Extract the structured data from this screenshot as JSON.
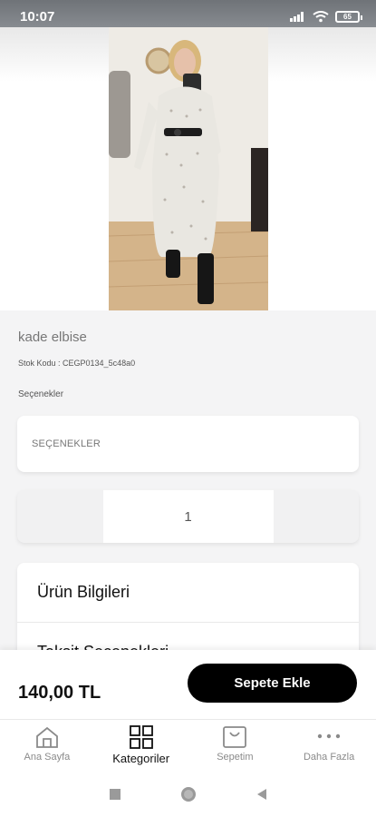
{
  "status_bar": {
    "time": "10:07",
    "battery": "65",
    "icons": [
      "signal-icon",
      "wifi-icon",
      "battery-icon"
    ]
  },
  "product": {
    "title": "kade elbise",
    "stock_code": "Stok Kodu : CEGP0134_5c48a0",
    "options_label": "Seçenekler",
    "options_placeholder": "SEÇENEKLER",
    "quantity": "1"
  },
  "info_sections": [
    {
      "label": "Ürün Bilgileri"
    },
    {
      "label": "Taksit Seçenekleri"
    }
  ],
  "purchase": {
    "price": "140,00 TL",
    "button_label": "Sepete Ekle"
  },
  "tabs": [
    {
      "label": "Ana Sayfa",
      "icon": "home-icon"
    },
    {
      "label": "Kategoriler",
      "icon": "grid-icon"
    },
    {
      "label": "Sepetim",
      "icon": "shopping-bag-icon"
    },
    {
      "label": "Daha Fazla",
      "icon": "more-dots-icon"
    }
  ],
  "colors": {
    "primary_button": "#000000",
    "active_tab": "#111111",
    "inactive_tab": "#8a8a8a",
    "background": "#f4f4f5"
  }
}
